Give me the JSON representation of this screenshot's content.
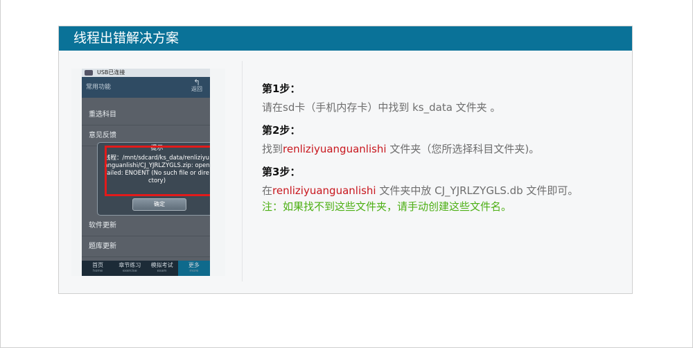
{
  "header": {
    "title": "线程出错解决方案"
  },
  "phone": {
    "status_text": "USB已连接",
    "titlebar": {
      "title": "常用功能",
      "back_label": "返回"
    },
    "list_items": [
      "重选科目",
      "意见反馈"
    ],
    "dialog": {
      "title": "提示",
      "message": "线程：/mnt/sdcard/ks_data/renliziyuanguanlishi/CJ_YJRLZYGLS.zip: open failed: ENOENT (No such file or directory)",
      "ok_label": "确定"
    },
    "lower_items": [
      "软件更新",
      "题库更新"
    ],
    "tabs": [
      {
        "label": "首页",
        "sub": "home"
      },
      {
        "label": "章节练习",
        "sub": "exercise"
      },
      {
        "label": "模拟考试",
        "sub": "exam"
      },
      {
        "label": "更多",
        "sub": "more"
      }
    ]
  },
  "steps": [
    {
      "title": "第1步：",
      "text_before": "请在sd卡（手机内存卡）中找到 ks_data 文件夹 。",
      "highlight": "",
      "text_after": ""
    },
    {
      "title": "第2步：",
      "text_before": "找到",
      "highlight": "renliziyuanguanlishi",
      "text_after": " 文件夹（您所选择科目文件夹)。"
    },
    {
      "title": "第3步：",
      "text_before": "在",
      "highlight": "renliziyuanguanlishi",
      "text_after": " 文件夹中放 CJ_YJRLZYGLS.db 文件即可。"
    }
  ],
  "note": "注：如果找不到这些文件夹，请手动创建这些文件名。",
  "colors": {
    "header_bg": "#0a7298",
    "highlight": "#c8161d",
    "note": "#4caf13",
    "dialog_border": "#e21a1a"
  }
}
